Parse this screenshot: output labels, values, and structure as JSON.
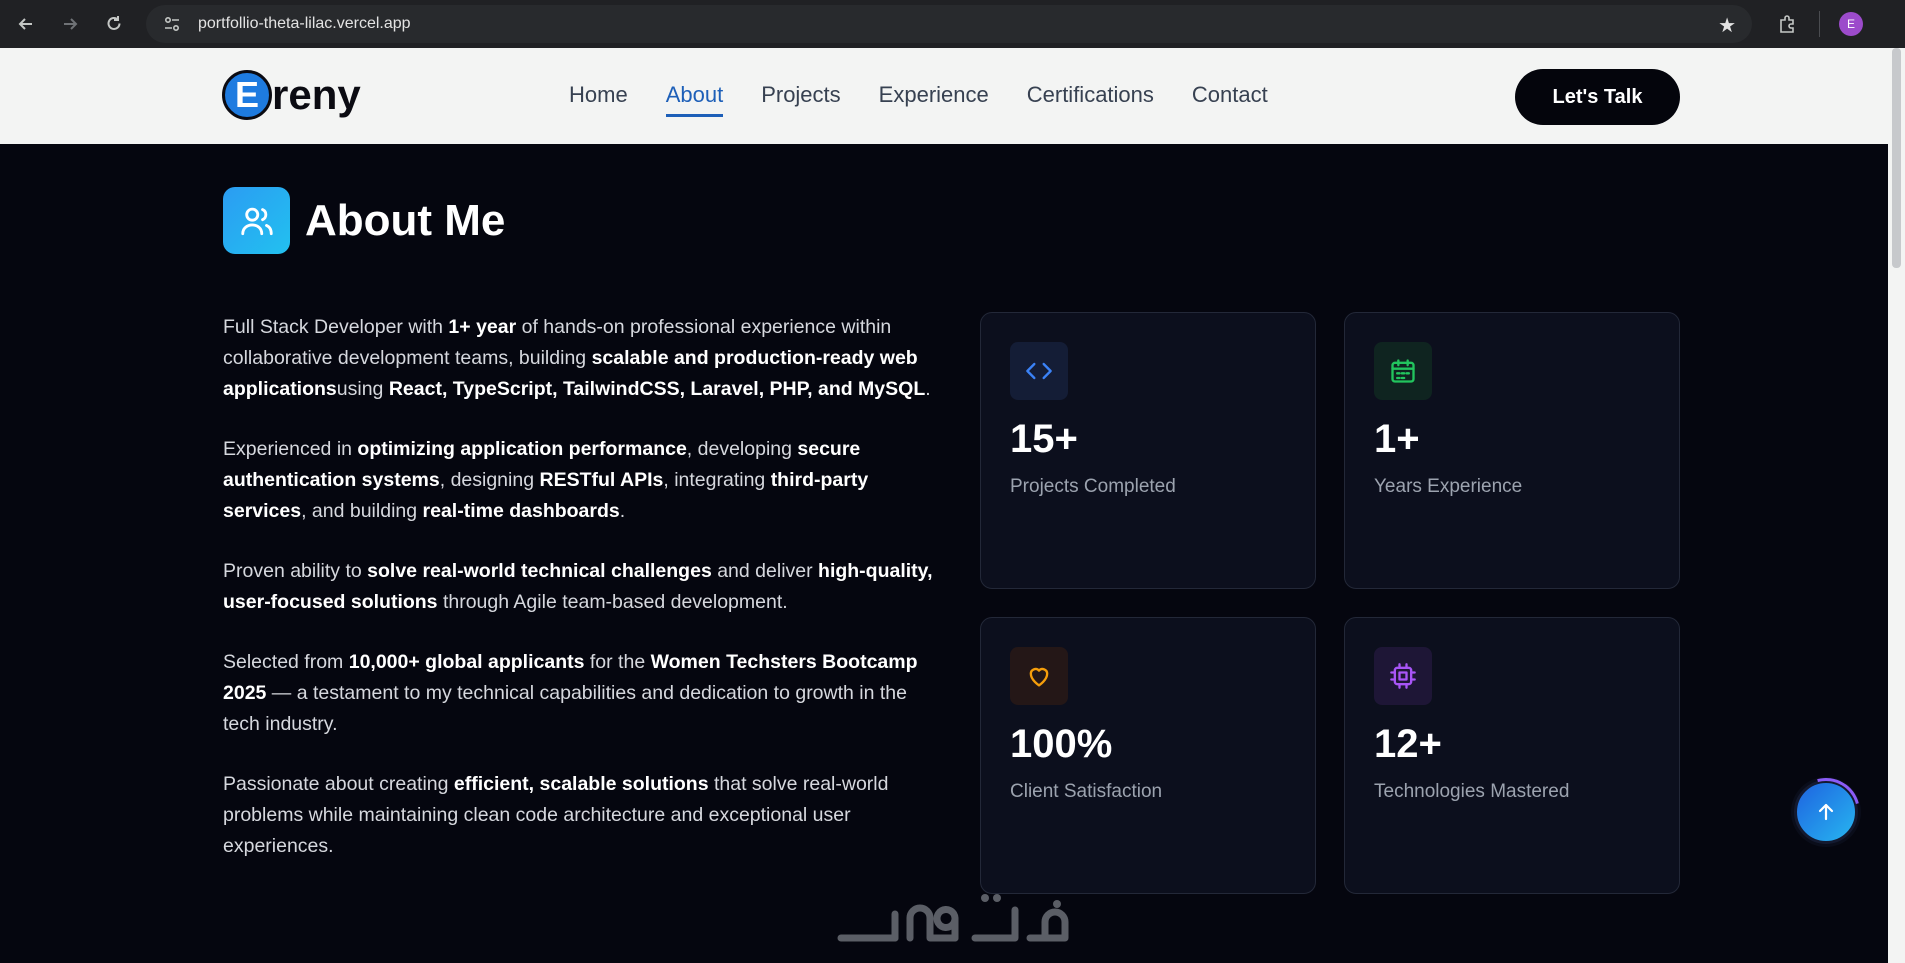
{
  "browser": {
    "url": "portfollio-theta-lilac.vercel.app",
    "profile_initial": "E",
    "icons": [
      "back-icon",
      "forward-icon",
      "reload-icon",
      "site-info-icon",
      "bookmark-star-icon",
      "extensions-icon"
    ]
  },
  "header": {
    "logo_letter": "E",
    "logo_rest": "reny",
    "nav": [
      {
        "label": "Home"
      },
      {
        "label": "About"
      },
      {
        "label": "Projects"
      },
      {
        "label": "Experience"
      },
      {
        "label": "Certifications"
      },
      {
        "label": "Contact"
      }
    ],
    "active_nav": "About",
    "cta_label": "Let's Talk"
  },
  "about": {
    "title": "About Me",
    "title_icon": "users-icon",
    "paragraphs": [
      [
        {
          "t": "Full Stack Developer with "
        },
        {
          "t": "1+ year",
          "b": true
        },
        {
          "t": " of hands-on professional experience within collaborative development teams, building "
        },
        {
          "t": "scalable and production-ready web applications",
          "b": true
        },
        {
          "t": "using "
        },
        {
          "t": "React, TypeScript, TailwindCSS, Laravel, PHP, and MySQL",
          "b": true
        },
        {
          "t": "."
        }
      ],
      [
        {
          "t": "Experienced in "
        },
        {
          "t": "optimizing application performance",
          "b": true
        },
        {
          "t": ", developing "
        },
        {
          "t": "secure authentication systems",
          "b": true
        },
        {
          "t": ", designing "
        },
        {
          "t": "RESTful APIs",
          "b": true
        },
        {
          "t": ", integrating "
        },
        {
          "t": "third-party services",
          "b": true
        },
        {
          "t": ", and building "
        },
        {
          "t": "real-time dashboards",
          "b": true
        },
        {
          "t": "."
        }
      ],
      [
        {
          "t": "Proven ability to "
        },
        {
          "t": "solve real-world technical challenges",
          "b": true
        },
        {
          "t": " and deliver "
        },
        {
          "t": "high-quality, user-focused solutions",
          "b": true
        },
        {
          "t": " through Agile team-based development."
        }
      ],
      [
        {
          "t": "Selected from "
        },
        {
          "t": "10,000+ global applicants",
          "b": true
        },
        {
          "t": " for the "
        },
        {
          "t": "Women Techsters Bootcamp 2025",
          "b": true
        },
        {
          "t": " — a testament to my technical capabilities and dedication to growth in the tech industry."
        }
      ],
      [
        {
          "t": "Passionate about creating "
        },
        {
          "t": "efficient, scalable solutions",
          "b": true
        },
        {
          "t": " that solve real-world problems while maintaining clean code architecture and exceptional user experiences."
        }
      ]
    ],
    "stats": [
      {
        "value": "15+",
        "label": "Projects Completed",
        "icon": "code-icon",
        "color": "#3b82f6",
        "bg": "#141d36"
      },
      {
        "value": "1+",
        "label": "Years Experience",
        "icon": "calendar-icon",
        "color": "#22c55e",
        "bg": "#0f2420"
      },
      {
        "value": "100%",
        "label": "Client Satisfaction",
        "icon": "heart-icon",
        "color": "#f59e0b",
        "bg": "#241717"
      },
      {
        "value": "12+",
        "label": "Technologies Mastered",
        "icon": "cpu-icon",
        "color": "#a855f7",
        "bg": "#1e1636"
      }
    ]
  },
  "scroll_to_top": {
    "icon": "arrow-up-icon"
  },
  "watermark": {
    "text": "خمسات"
  }
}
